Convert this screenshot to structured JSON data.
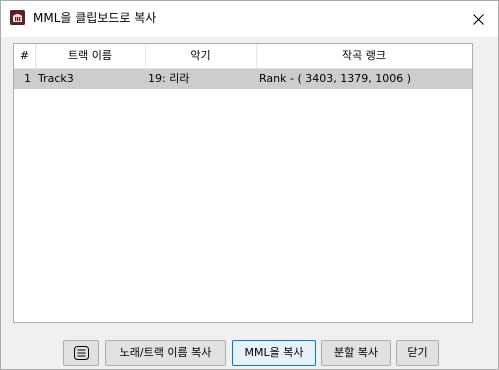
{
  "window": {
    "title": "MML을 클립보드로 복사"
  },
  "table": {
    "columns": [
      "#",
      "트랙 이름",
      "악기",
      "작곡 랭크"
    ],
    "rows": [
      {
        "num": "1",
        "name": "Track3",
        "instrument": "19: 리라",
        "rank": "Rank - ( 3403, 1379, 1006 )"
      }
    ]
  },
  "buttons": {
    "copy_with_name": "노래/트랙 이름 복사",
    "copy_mml": "MML을 복사",
    "split_copy": "분할 복사",
    "close": "닫기"
  },
  "icons": {
    "app": "app-icon",
    "close": "close-icon",
    "list": "list-icon"
  }
}
